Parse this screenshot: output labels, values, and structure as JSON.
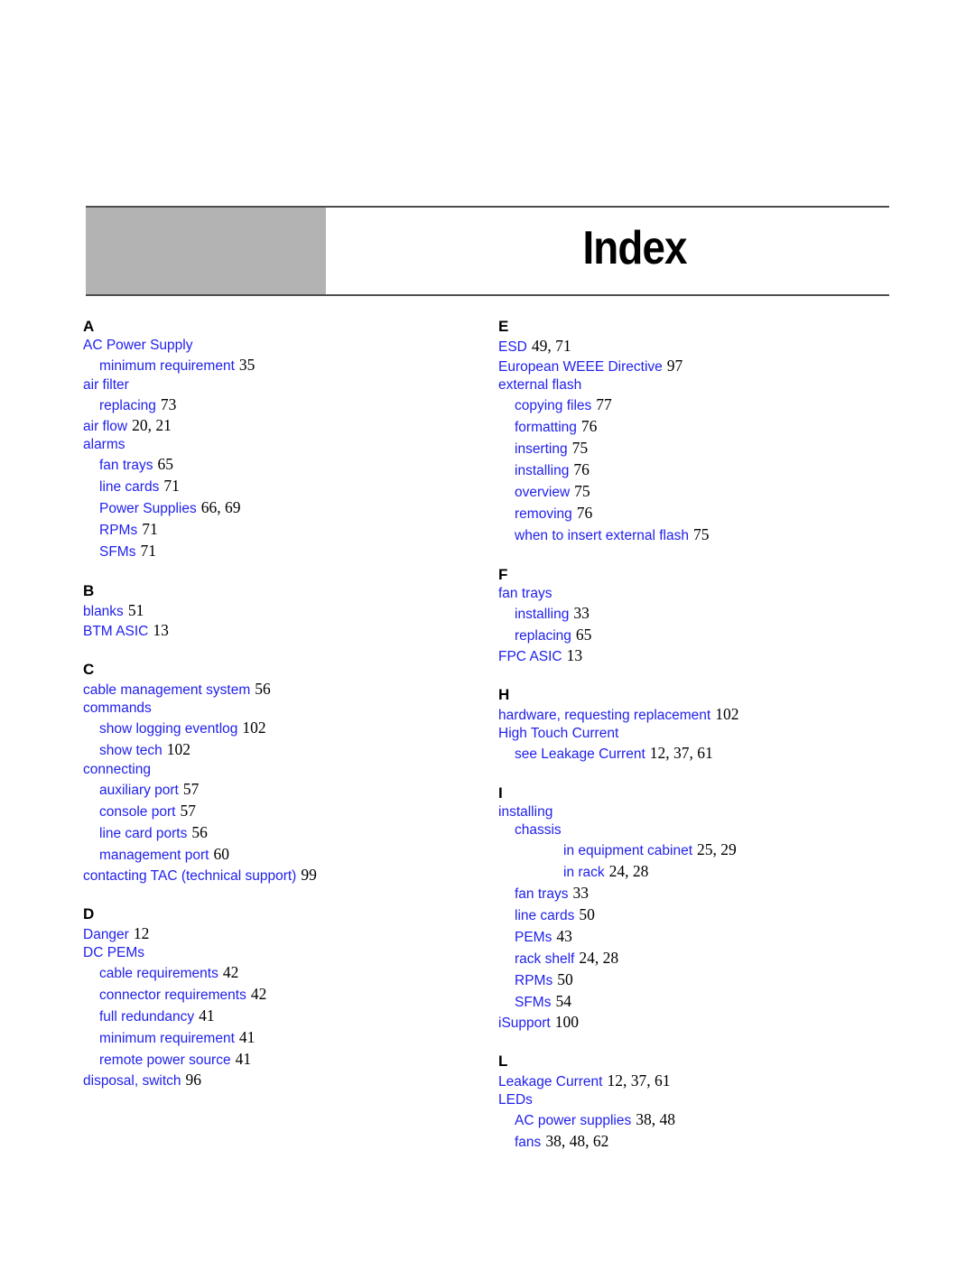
{
  "header": {
    "title": "Index"
  },
  "colors": {
    "entry_blue": "#2121ec",
    "page_number_black": "#000000",
    "banner_gray": "#b3b3b3",
    "rule_gray": "#4d4d4d"
  },
  "columns": [
    {
      "name": "left",
      "sections": [
        {
          "letter": "A",
          "entries": [
            {
              "level": 0,
              "text": "AC Power Supply",
              "pages": ""
            },
            {
              "level": 1,
              "text": "minimum requirement",
              "pages": "35"
            },
            {
              "level": 0,
              "text": "air filter",
              "pages": ""
            },
            {
              "level": 1,
              "text": "replacing",
              "pages": "73"
            },
            {
              "level": 0,
              "text": "air flow",
              "pages": "20, 21"
            },
            {
              "level": 0,
              "text": "alarms",
              "pages": ""
            },
            {
              "level": 1,
              "text": "fan trays",
              "pages": "65"
            },
            {
              "level": 1,
              "text": "line cards",
              "pages": "71"
            },
            {
              "level": 1,
              "text": "Power Supplies",
              "pages": "66, 69"
            },
            {
              "level": 1,
              "text": "RPMs",
              "pages": "71"
            },
            {
              "level": 1,
              "text": "SFMs",
              "pages": "71"
            }
          ]
        },
        {
          "letter": "B",
          "entries": [
            {
              "level": 0,
              "text": "blanks",
              "pages": "51"
            },
            {
              "level": 0,
              "text": "BTM ASIC",
              "pages": "13"
            }
          ]
        },
        {
          "letter": "C",
          "entries": [
            {
              "level": 0,
              "text": "cable management system",
              "pages": "56"
            },
            {
              "level": 0,
              "text": "commands",
              "pages": ""
            },
            {
              "level": 1,
              "text": "show logging eventlog",
              "pages": "102"
            },
            {
              "level": 1,
              "text": "show tech",
              "pages": "102"
            },
            {
              "level": 0,
              "text": "connecting",
              "pages": ""
            },
            {
              "level": 1,
              "text": "auxiliary port",
              "pages": "57"
            },
            {
              "level": 1,
              "text": "console port",
              "pages": "57"
            },
            {
              "level": 1,
              "text": "line card ports",
              "pages": "56"
            },
            {
              "level": 1,
              "text": "management port",
              "pages": "60"
            },
            {
              "level": 0,
              "text": "contacting TAC (technical support)",
              "pages": "99"
            }
          ]
        },
        {
          "letter": "D",
          "entries": [
            {
              "level": 0,
              "text": "Danger",
              "pages": "12"
            },
            {
              "level": 0,
              "text": "DC PEMs",
              "pages": ""
            },
            {
              "level": 1,
              "text": "cable requirements",
              "pages": "42"
            },
            {
              "level": 1,
              "text": "connector requirements",
              "pages": "42"
            },
            {
              "level": 1,
              "text": "full redundancy",
              "pages": "41"
            },
            {
              "level": 1,
              "text": "minimum requirement",
              "pages": "41"
            },
            {
              "level": 1,
              "text": "remote power source",
              "pages": "41"
            },
            {
              "level": 0,
              "text": "disposal, switch",
              "pages": "96"
            }
          ]
        }
      ]
    },
    {
      "name": "right",
      "sections": [
        {
          "letter": "E",
          "entries": [
            {
              "level": 0,
              "text": "ESD",
              "pages": "49, 71"
            },
            {
              "level": 0,
              "text": "European WEEE Directive",
              "pages": "97"
            },
            {
              "level": 0,
              "text": "external flash",
              "pages": ""
            },
            {
              "level": 1,
              "text": "copying files",
              "pages": "77"
            },
            {
              "level": 1,
              "text": "formatting",
              "pages": "76"
            },
            {
              "level": 1,
              "text": "inserting",
              "pages": "75"
            },
            {
              "level": 1,
              "text": "installing",
              "pages": "76"
            },
            {
              "level": 1,
              "text": "overview",
              "pages": "75"
            },
            {
              "level": 1,
              "text": "removing",
              "pages": "76"
            },
            {
              "level": 1,
              "text": "when to insert external flash",
              "pages": "75"
            }
          ]
        },
        {
          "letter": "F",
          "entries": [
            {
              "level": 0,
              "text": "fan trays",
              "pages": ""
            },
            {
              "level": 1,
              "text": "installing",
              "pages": "33"
            },
            {
              "level": 1,
              "text": "replacing",
              "pages": "65"
            },
            {
              "level": 0,
              "text": "FPC ASIC",
              "pages": "13"
            }
          ]
        },
        {
          "letter": "H",
          "entries": [
            {
              "level": 0,
              "text": "hardware, requesting replacement",
              "pages": "102"
            },
            {
              "level": 0,
              "text": "High Touch Current",
              "pages": ""
            },
            {
              "level": 1,
              "text": "see Leakage Current",
              "pages": "12, 37, 61"
            }
          ]
        },
        {
          "letter": "I",
          "entries": [
            {
              "level": 0,
              "text": "installing",
              "pages": ""
            },
            {
              "level": 1,
              "text": "chassis",
              "pages": ""
            },
            {
              "level": 2,
              "text": "in equipment cabinet",
              "pages": "25, 29"
            },
            {
              "level": 2,
              "text": "in rack",
              "pages": "24, 28"
            },
            {
              "level": 1,
              "text": "fan trays",
              "pages": "33"
            },
            {
              "level": 1,
              "text": "line cards",
              "pages": "50"
            },
            {
              "level": 1,
              "text": "PEMs",
              "pages": "43"
            },
            {
              "level": 1,
              "text": "rack shelf",
              "pages": "24, 28"
            },
            {
              "level": 1,
              "text": "RPMs",
              "pages": "50"
            },
            {
              "level": 1,
              "text": "SFMs",
              "pages": "54"
            },
            {
              "level": 0,
              "text": "iSupport",
              "pages": "100"
            }
          ]
        },
        {
          "letter": "L",
          "entries": [
            {
              "level": 0,
              "text": "Leakage Current",
              "pages": "12, 37, 61"
            },
            {
              "level": 0,
              "text": "LEDs",
              "pages": ""
            },
            {
              "level": 1,
              "text": "AC power supplies",
              "pages": "38, 48"
            },
            {
              "level": 1,
              "text": "fans",
              "pages": "38, 48, 62"
            }
          ]
        }
      ]
    }
  ]
}
